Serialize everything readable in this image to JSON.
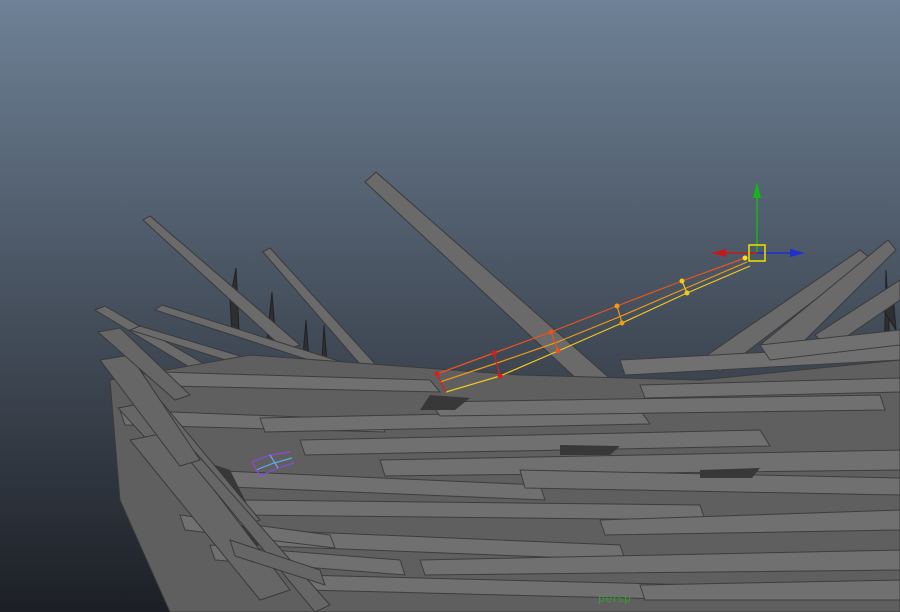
{
  "viewport": {
    "camera_name": "persp",
    "background_top": "#6e8196",
    "background_bottom": "#1c1f25"
  },
  "scene": {
    "mesh_color": "#6b6b6b",
    "mesh_edge_color": "#3b3b3b",
    "mesh_dark_color": "#2a2a2a"
  },
  "gizmo": {
    "x_axis_color": "#1f2fd1",
    "y_axis_color": "#17b51a",
    "neg_x_color": "#c21a1a",
    "center_color": "#f0e000"
  },
  "deformer_chain": {
    "colors": [
      "#d81e1e",
      "#e8541e",
      "#f09a18",
      "#f5c81a",
      "#ffe020"
    ]
  },
  "secondary_chain": {
    "colors": [
      "#8a4ae0",
      "#5fa8e8"
    ]
  }
}
